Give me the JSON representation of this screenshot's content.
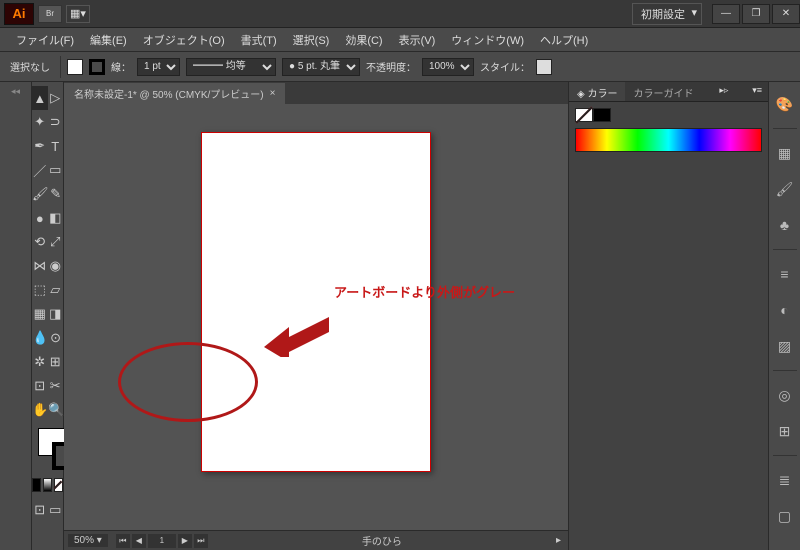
{
  "titlebar": {
    "logo": "Ai",
    "br": "Br",
    "workspace": "初期設定"
  },
  "menu": {
    "file": "ファイル(F)",
    "edit": "編集(E)",
    "object": "オブジェクト(O)",
    "format": "書式(T)",
    "select": "選択(S)",
    "effect": "効果(C)",
    "view": "表示(V)",
    "window": "ウィンドウ(W)",
    "help": "ヘルプ(H)"
  },
  "ctrl": {
    "sel": "選択なし",
    "stroke": "線：",
    "stroke_w": "1 pt",
    "dash": "均等",
    "brush": "5 pt. 丸筆",
    "opacity_lbl": "不透明度：",
    "opacity": "100%",
    "style_lbl": "スタイル："
  },
  "doc": {
    "tab": "名称未設定-1* @ 50% (CMYK/プレビュー)",
    "close": "×"
  },
  "status": {
    "zoom": "50%",
    "page": "1",
    "tool": "手のひら"
  },
  "panels": {
    "color": "カラー",
    "colorguide": "カラーガイド",
    "expand": "▸▹",
    "menu": "▾≡"
  },
  "annot": {
    "text": "アートボードより外側がグレー"
  }
}
